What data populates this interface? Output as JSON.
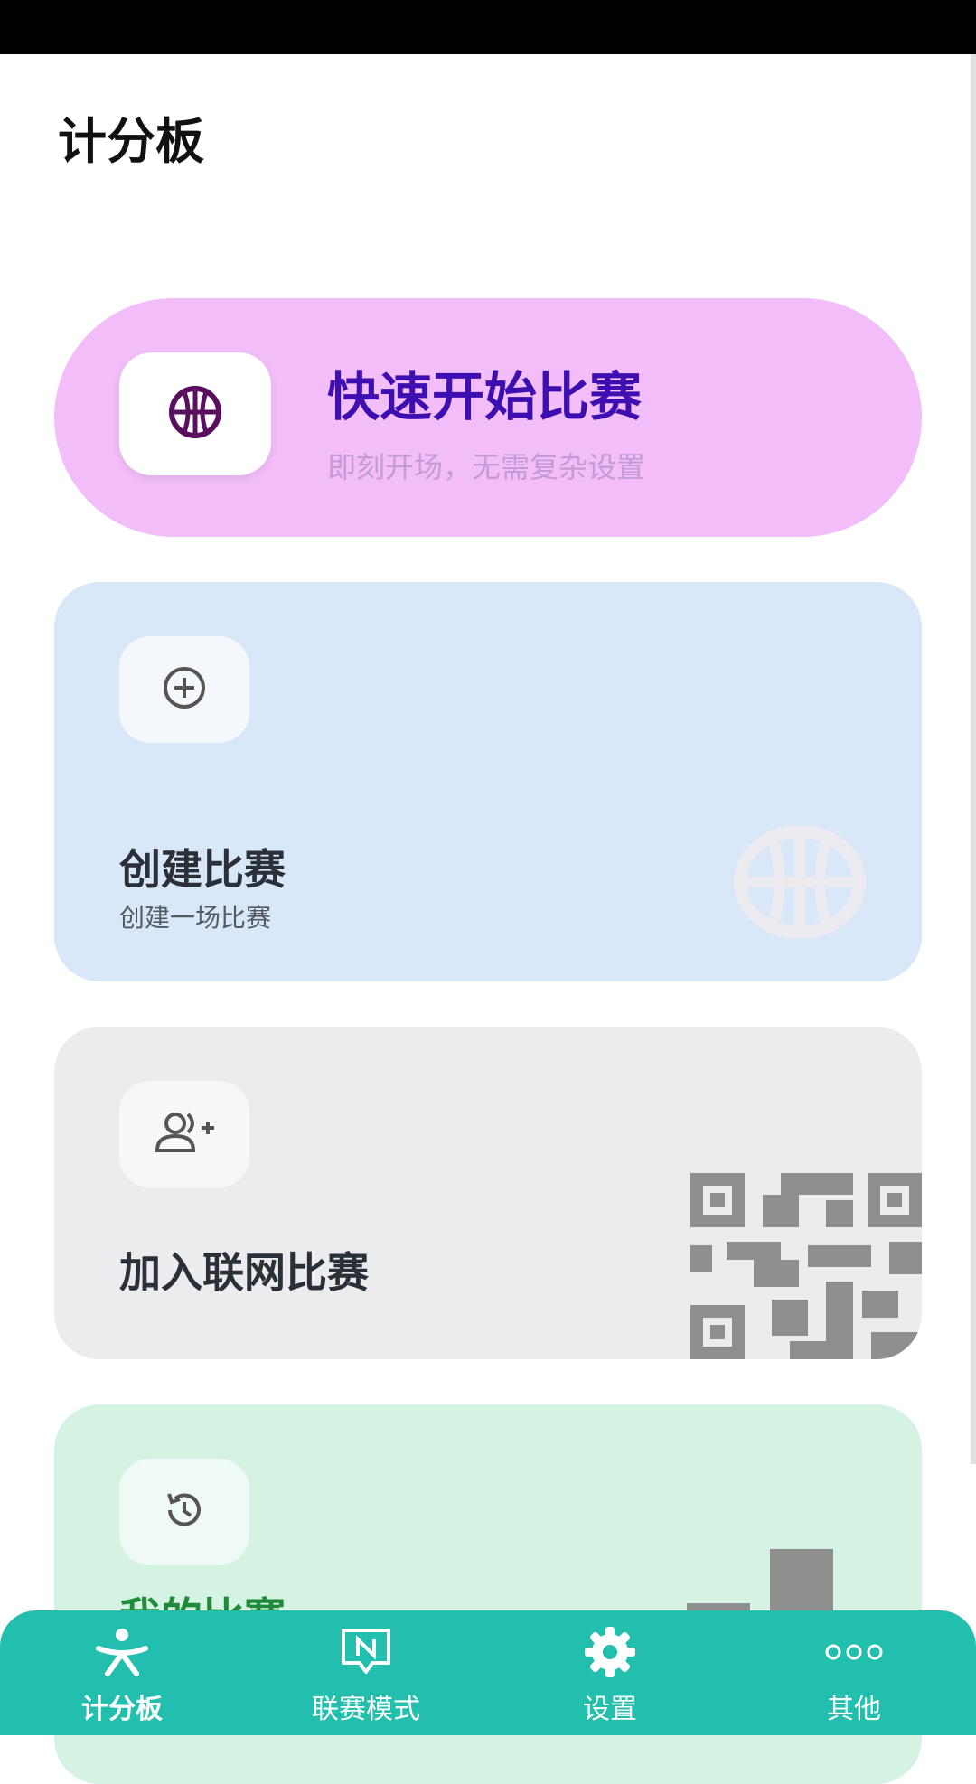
{
  "page_title": "计分板",
  "quick_start": {
    "title": "快速开始比赛",
    "subtitle": "即刻开场，无需复杂设置",
    "icon": "basketball-icon"
  },
  "create_match": {
    "title": "创建比赛",
    "subtitle": "创建一场比赛",
    "icon": "add-circle-icon"
  },
  "join_match": {
    "title": "加入联网比赛",
    "icon": "person-add-icon"
  },
  "my_matches": {
    "title": "我的比赛",
    "icon": "history-icon"
  },
  "tabs": [
    {
      "label": "计分板",
      "icon": "scoreboard-icon",
      "active": true
    },
    {
      "label": "联赛模式",
      "icon": "league-icon",
      "active": false
    },
    {
      "label": "设置",
      "icon": "gear-icon",
      "active": false
    },
    {
      "label": "其他",
      "icon": "more-icon",
      "active": false
    }
  ],
  "colors": {
    "quick_card": "#f3bdfa",
    "create_card": "#d9e8f9",
    "join_card": "#ececee",
    "mine_card": "#d4f3e2",
    "tab_bar": "#22bfae",
    "quick_title": "#3d0fb0"
  }
}
